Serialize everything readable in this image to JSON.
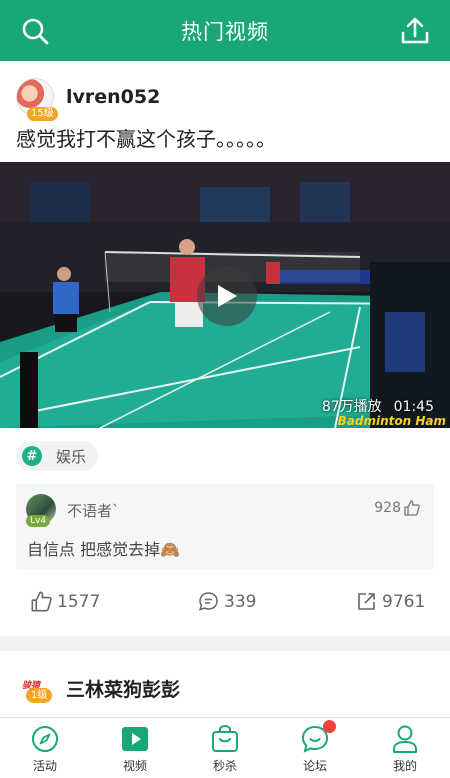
{
  "header": {
    "title": "热门视频"
  },
  "post": {
    "author": "lvren052",
    "author_level": "15级",
    "text": "感觉我打不赢这个孩子。。。。。",
    "video": {
      "views": "87万播放",
      "duration": "01:45",
      "watermark": "Badminton Ham"
    },
    "tag": "娱乐",
    "top_comment": {
      "author": "不语者`",
      "level": "Lv4",
      "likes": "928",
      "text": "自信点 把感觉去掉🙈"
    },
    "actions": {
      "likes": "1577",
      "comments": "339",
      "shares": "9761"
    }
  },
  "post2": {
    "author": "三林菜狗彭彭",
    "author_level": "1级",
    "avatar_logo": "骏猿"
  },
  "tabbar": {
    "items": [
      {
        "label": "活动",
        "icon": "compass-icon"
      },
      {
        "label": "视频",
        "icon": "video-play-icon"
      },
      {
        "label": "秒杀",
        "icon": "shopping-bag-icon"
      },
      {
        "label": "论坛",
        "icon": "chat-bubble-icon"
      },
      {
        "label": "我的",
        "icon": "person-icon"
      }
    ],
    "active_index": 1,
    "accent": "#19a779",
    "notification_color": "#f24141"
  }
}
